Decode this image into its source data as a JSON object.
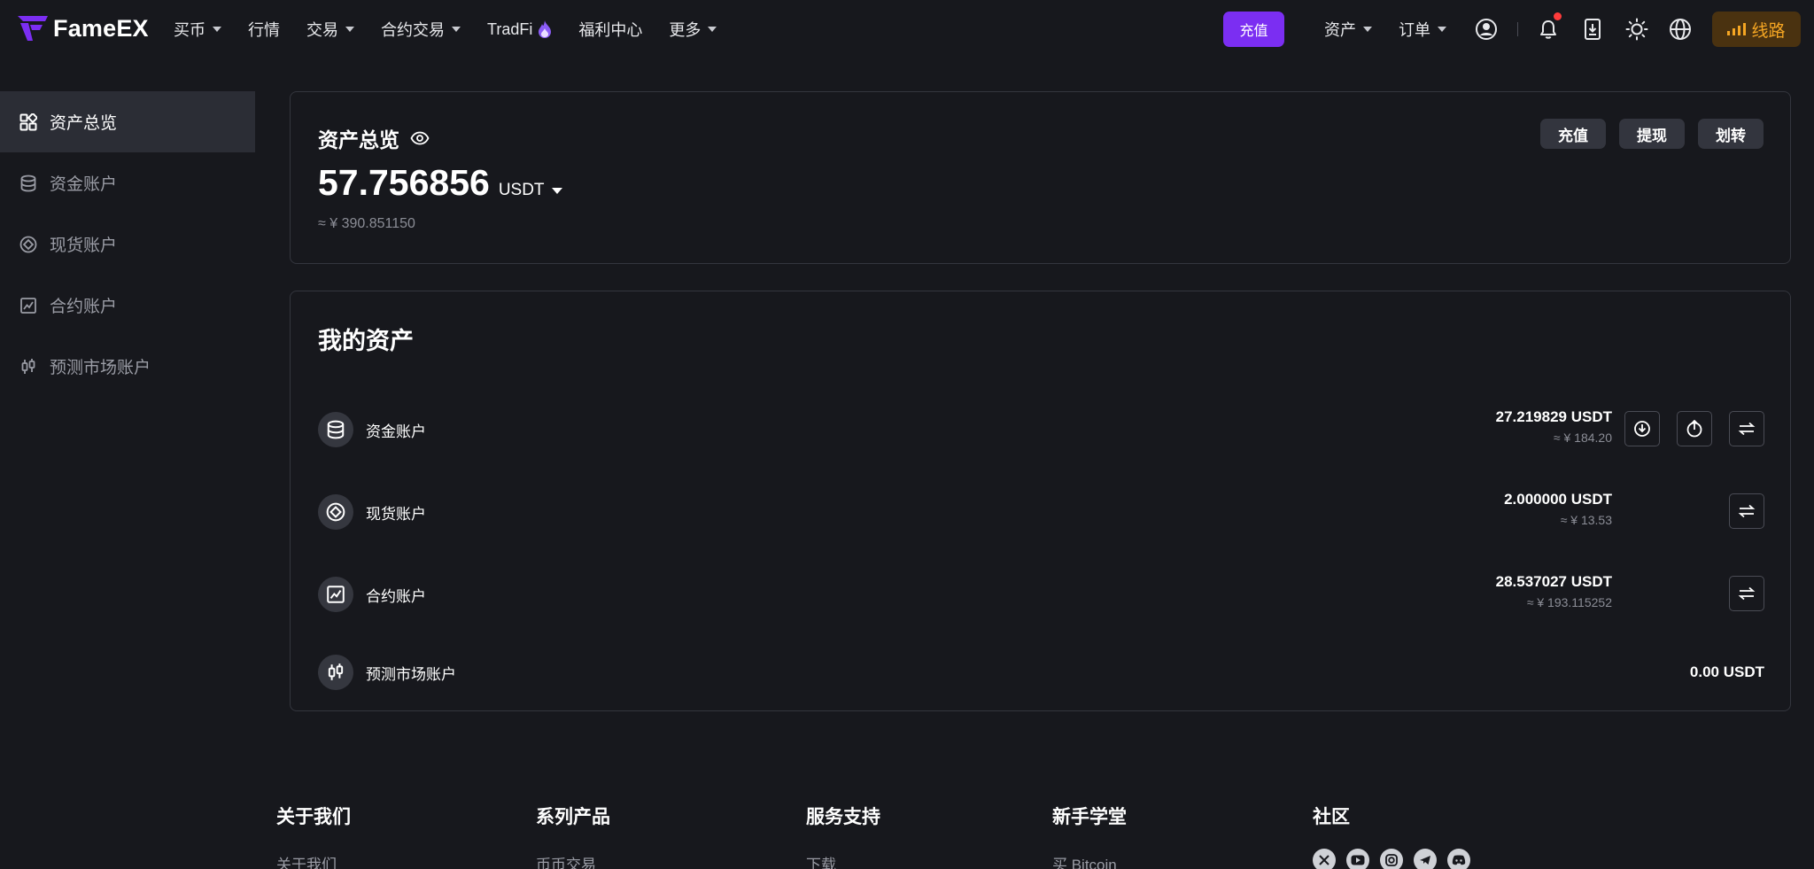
{
  "brand": {
    "name": "FameEX",
    "accent": "#7b2ef2"
  },
  "nav": {
    "items": [
      {
        "label": "买币",
        "dropdown": true
      },
      {
        "label": "行情",
        "dropdown": false
      },
      {
        "label": "交易",
        "dropdown": true
      },
      {
        "label": "合约交易",
        "dropdown": true
      },
      {
        "label": "TradFi",
        "dropdown": false,
        "icon": "fire-icon"
      },
      {
        "label": "福利中心",
        "dropdown": false
      },
      {
        "label": "更多",
        "dropdown": true
      }
    ],
    "deposit_label": "充值",
    "assets_label": "资产",
    "orders_label": "订单",
    "line_label": "线路"
  },
  "sidebar": {
    "items": [
      {
        "label": "资产总览",
        "icon": "grid-icon",
        "active": true
      },
      {
        "label": "资金账户",
        "icon": "database-icon",
        "active": false
      },
      {
        "label": "现货账户",
        "icon": "diamond-coin-icon",
        "active": false
      },
      {
        "label": "合约账户",
        "icon": "chart-box-icon",
        "active": false
      },
      {
        "label": "预测市场账户",
        "icon": "candlestick-icon",
        "active": false
      }
    ]
  },
  "overview": {
    "title": "资产总览",
    "amount": "57.756856",
    "unit": "USDT",
    "approx": "≈ ¥ 390.851150",
    "actions": {
      "deposit": "充值",
      "withdraw": "提现",
      "transfer": "划转"
    }
  },
  "assets": {
    "title": "我的资产",
    "rows": [
      {
        "name": "资金账户",
        "value": "27.219829 USDT",
        "cny": "≈ ¥ 184.20",
        "icon": "database-icon"
      },
      {
        "name": "现货账户",
        "value": "2.000000 USDT",
        "cny": "≈ ¥ 13.53",
        "icon": "diamond-coin-icon"
      },
      {
        "name": "合约账户",
        "value": "28.537027 USDT",
        "cny": "≈ ¥ 193.115252",
        "icon": "chart-box-icon"
      },
      {
        "name": "预测市场账户",
        "value": "0.00 USDT",
        "cny": "",
        "icon": "candlestick-icon"
      }
    ]
  },
  "footer": {
    "columns": [
      {
        "title": "关于我们",
        "first_link": "关于我们"
      },
      {
        "title": "系列产品",
        "first_link": "币币交易"
      },
      {
        "title": "服务支持",
        "first_link": "下载"
      },
      {
        "title": "新手学堂",
        "first_link": "买 Bitcoin"
      },
      {
        "title": "社区",
        "social": [
          "x-icon",
          "youtube-icon",
          "instagram-icon",
          "telegram-icon",
          "discord-icon"
        ]
      }
    ]
  }
}
